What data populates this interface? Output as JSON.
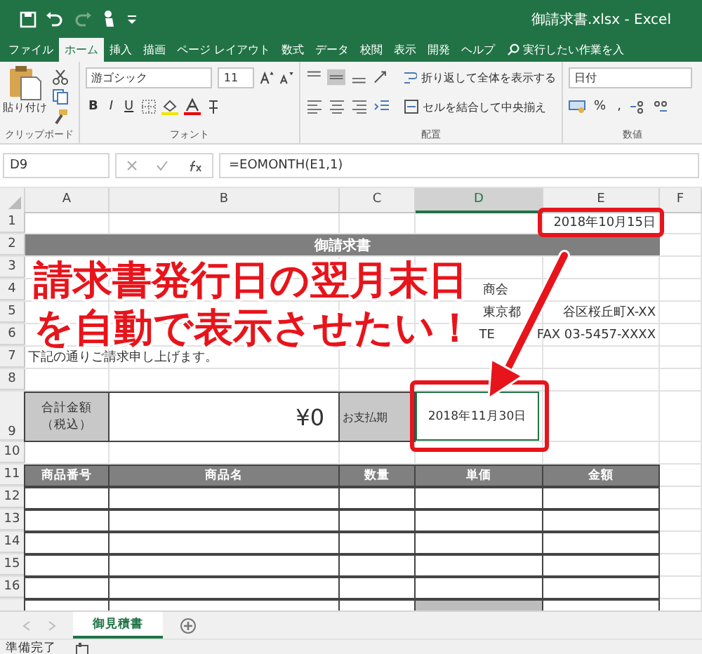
{
  "window": {
    "title": "御請求書.xlsx - Excel"
  },
  "ribbon_tabs": [
    {
      "label": "ファイル",
      "selected": false
    },
    {
      "label": "ホーム",
      "selected": true
    },
    {
      "label": "挿入",
      "selected": false
    },
    {
      "label": "描画",
      "selected": false
    },
    {
      "label": "ページ レイアウト",
      "selected": false
    },
    {
      "label": "数式",
      "selected": false
    },
    {
      "label": "データ",
      "selected": false
    },
    {
      "label": "校閲",
      "selected": false
    },
    {
      "label": "表示",
      "selected": false
    },
    {
      "label": "開発",
      "selected": false
    },
    {
      "label": "ヘルプ",
      "selected": false
    }
  ],
  "tell_me": {
    "placeholder": "実行したい作業を入"
  },
  "ribbon": {
    "paste_label": "貼り付け",
    "font_name": "游ゴシック",
    "font_size": "11",
    "bold": "B",
    "italic": "I",
    "underline": "U",
    "wrap_text": "折り返して全体を表示する",
    "merge_center": "セルを結合して中央揃え",
    "number_format": "日付",
    "percent": "%",
    "comma": ",",
    "groups": [
      "クリップボード",
      "フォント",
      "配置",
      "数値"
    ]
  },
  "formula_bar": {
    "name_box": "D9",
    "formula": "=EOMONTH(E1,1)"
  },
  "sheet": {
    "columns": [
      {
        "label": "A",
        "selected": false
      },
      {
        "label": "B",
        "selected": false
      },
      {
        "label": "C",
        "selected": false
      },
      {
        "label": "D",
        "selected": true
      },
      {
        "label": "E",
        "selected": false
      },
      {
        "label": "F",
        "selected": false
      }
    ],
    "rows": [
      {
        "number": "1",
        "kind": "date",
        "value": "2018年10月15日",
        "highlighted": true
      },
      {
        "number": "2",
        "kind": "title",
        "text": "御請求書"
      },
      {
        "number": "3",
        "kind": "blank"
      },
      {
        "number": "4",
        "kind": "company",
        "texts": [
          "商会"
        ]
      },
      {
        "number": "5",
        "kind": "address",
        "texts": [
          "東京都",
          "谷区桜丘町X-XX"
        ]
      },
      {
        "number": "6",
        "kind": "address",
        "texts": [
          "TE",
          "FAX 03-5457-XXXX"
        ]
      },
      {
        "number": "7",
        "kind": "note",
        "text": "下記の通りご請求申し上げます。"
      },
      {
        "number": "8",
        "kind": "blank"
      },
      {
        "number": "9",
        "kind": "total",
        "label": "合計金額",
        "sublabel": "（税込）",
        "amount": "¥0",
        "due_label": "お支払期",
        "due_value": "2018年11月30日",
        "selected": true,
        "highlighted": true
      },
      {
        "number": "10",
        "kind": "blank"
      },
      {
        "number": "11",
        "kind": "header",
        "cells": [
          "商品番号",
          "商品名",
          "数量",
          "単価",
          "金額"
        ]
      },
      {
        "number": "12",
        "kind": "item"
      },
      {
        "number": "13",
        "kind": "item"
      },
      {
        "number": "14",
        "kind": "item"
      },
      {
        "number": "15",
        "kind": "item"
      },
      {
        "number": "16",
        "kind": "item"
      }
    ]
  },
  "annotation": {
    "lines": [
      "請求書発行日の翌月末日",
      "を自動で表示させたい！"
    ]
  },
  "sheet_tabs": [
    {
      "label": "御見積書",
      "selected": true
    }
  ],
  "status_bar": {
    "text": "準備完了"
  }
}
